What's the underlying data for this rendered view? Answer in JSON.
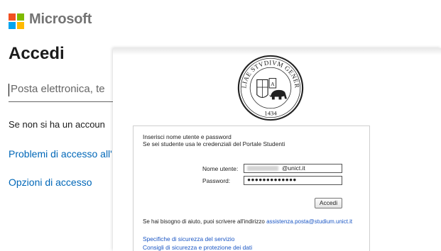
{
  "microsoft": {
    "brand": "Microsoft",
    "title": "Accedi",
    "email_placeholder": "Posta elettronica, te",
    "no_account_text": "Se non si ha un accoun",
    "links": [
      "Problemi di accesso all'",
      "Opzioni di accesso"
    ]
  },
  "sso": {
    "seal_text_top": "SICILIAE STVDIVM GENERALE",
    "seal_year": "1434",
    "intro_line1": "Inserisci nome utente e password",
    "intro_line2": "Se sei studente usa le credenziali del Portale Studenti",
    "username_label": "Nome utente:",
    "username_value": "@unict.it",
    "password_label": "Password:",
    "password_value": "●●●●●●●●●●●●●",
    "submit_label": "Accedi",
    "help_text": "Se hai bisogno di aiuto, puoi scrivere all'indirizzo",
    "help_email": "assistenza.posta@studium.unict.it",
    "link1": "Specifiche di sicurezza del servizio",
    "link2": "Consigli di sicurezza e protezione dei dati"
  },
  "colors": {
    "ms_red": "#f25022",
    "ms_green": "#7fba00",
    "ms_blue": "#00a4ef",
    "ms_yellow": "#ffb900",
    "link_blue": "#0067b8",
    "sso_link_blue": "#1a56c4"
  }
}
